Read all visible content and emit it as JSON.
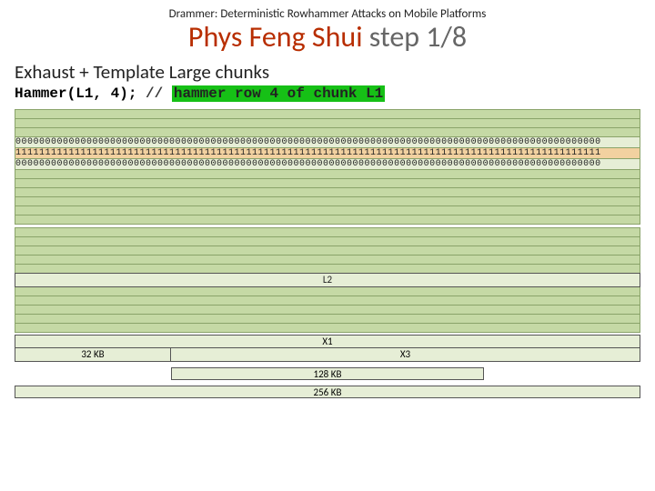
{
  "header": "Drammer: Deterministic Rowhammer Attacks on Mobile Platforms",
  "title_main": "Phys Feng Shui ",
  "title_step": "step 1/8",
  "subtitle": "Exhaust + Template Large chunks",
  "code": {
    "call": "Hammer(L1, 4); ",
    "slashes": "// ",
    "comment": "hammer row 4 of chunk L1"
  },
  "rows": {
    "zeros_top": "000000000000000000000000000000000000000000000000000000000000000000000000000000000000000000000000000",
    "ones": "111111111111111111111111111111111111111111111111111111111111111111111111111111111111111111111111111",
    "zeros_bot": "000000000000000000000000000000000000000000000000000000000000000000000000000000000000000000000000000"
  },
  "labels": {
    "l2": "L2",
    "x1": "X1",
    "kb32": "32 KB",
    "x3": "X3",
    "kb128": "128 KB",
    "kb256": "256 KB"
  }
}
